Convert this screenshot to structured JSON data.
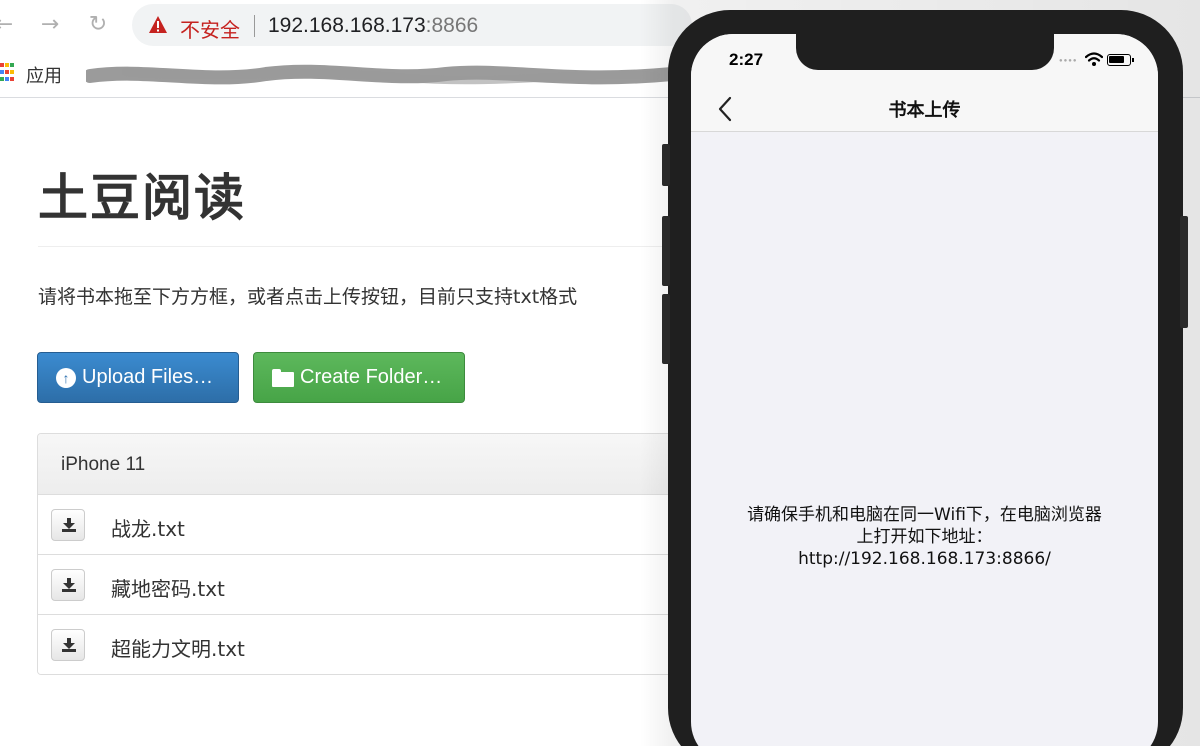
{
  "browser": {
    "security_label": "不安全",
    "url_host": "192.168.168.173",
    "url_port": ":8866",
    "bookmarks_apps_label": "应用"
  },
  "page": {
    "title": "土豆阅读",
    "instructions": "请将书本拖至下方方框，或者点击上传按钮，目前只支持txt格式",
    "upload_button": "Upload Files…",
    "create_folder_button": "Create Folder…",
    "panel_heading": "iPhone 11",
    "files": [
      {
        "name": "战龙.txt"
      },
      {
        "name": "藏地密码.txt"
      },
      {
        "name": "超能力文明.txt"
      }
    ]
  },
  "phone": {
    "time": "2:27",
    "nav_title": "书本上传",
    "message_lines": [
      "请确保手机和电脑在同一Wifi下，在电脑浏览器",
      "上打开如下地址：",
      "http://192.168.168.173:8866/"
    ]
  },
  "colors": {
    "upload_button": "#337ab7",
    "create_folder_button": "#5cb85c",
    "insecure_red": "#c5221f",
    "phone_frame": "#1f1f1f"
  },
  "icons": {
    "back": "arrow-left-icon",
    "forward": "arrow-right-icon",
    "reload": "reload-icon",
    "warning": "warning-triangle-icon",
    "apps": "apps-grid-icon",
    "upload": "upload-circle-icon",
    "folder": "folder-icon",
    "download": "download-icon",
    "wifi": "wifi-icon",
    "battery": "battery-icon",
    "nav_back": "chevron-left-icon"
  }
}
